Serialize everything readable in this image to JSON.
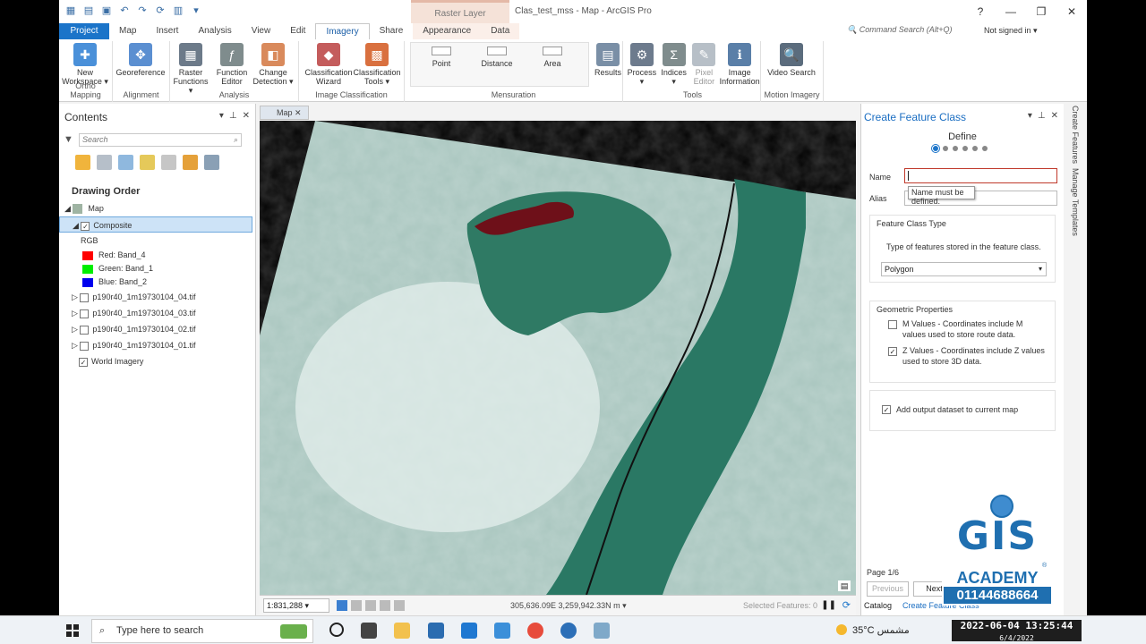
{
  "window": {
    "context_label": "Raster Layer",
    "title": "Clas_test_mss - Map - ArcGIS Pro",
    "help": "?",
    "minimize": "—",
    "restore": "❐",
    "close": "✕"
  },
  "tabs": [
    "Project",
    "Map",
    "Insert",
    "Analysis",
    "View",
    "Edit",
    "Imagery",
    "Share",
    "Appearance",
    "Data"
  ],
  "command_search": "Command Search (Alt+Q)",
  "signed_in": "Not signed in ▾",
  "ribbon": {
    "groups": [
      {
        "label": "Ortho Mapping",
        "buttons": [
          {
            "label": "New Workspace ▾",
            "color": "#4a90d9"
          }
        ]
      },
      {
        "label": "Alignment",
        "buttons": [
          {
            "label": "Georeference",
            "color": "#5b8fd1"
          }
        ]
      },
      {
        "label": "Analysis",
        "buttons": [
          {
            "label": "Raster Functions ▾",
            "color": "#6c7a89"
          },
          {
            "label": "Function Editor",
            "color": "#7f8c8d"
          },
          {
            "label": "Change Detection ▾",
            "color": "#d98a5c"
          }
        ]
      },
      {
        "label": "Image Classification",
        "buttons": [
          {
            "label": "Classification Wizard",
            "color": "#c45c5c"
          },
          {
            "label": "Classification Tools ▾",
            "color": "#d9703f"
          }
        ]
      },
      {
        "label": "Tools",
        "buttons": [
          {
            "label": "Process ▾",
            "color": "#6d7b8d"
          },
          {
            "label": "Indices ▾",
            "color": "#7f8c8d"
          },
          {
            "label": "Pixel Editor",
            "color": "#b7bfc7"
          },
          {
            "label": "Image Information",
            "color": "#5a7fa8"
          }
        ]
      },
      {
        "label": "Motion Imagery",
        "buttons": [
          {
            "label": "Video Search",
            "color": "#5b6c7d"
          }
        ]
      }
    ],
    "mensuration": {
      "label": "Mensuration",
      "buttons": [
        "Point",
        "Distance",
        "Area"
      ],
      "results": "Results"
    }
  },
  "contents": {
    "title": "Contents",
    "search_placeholder": "Search",
    "drawing_order": "Drawing Order",
    "map": "Map",
    "layers": {
      "composite": "Composite",
      "rgb": "RGB",
      "red": "Red:   Band_4",
      "green": "Green: Band_1",
      "blue": "Blue:  Band_2",
      "b4": "p190r40_1m19730104_04.tif",
      "b3": "p190r40_1m19730104_03.tif",
      "b2": "p190r40_1m19730104_02.tif",
      "b1": "p190r40_1m19730104_01.tif",
      "world": "World Imagery"
    },
    "colors": {
      "red": "#ff0000",
      "green": "#00ee00",
      "blue": "#0000ee"
    }
  },
  "map": {
    "tab": "Map",
    "scale": "1:831,288",
    "coords": "305,636.09E 3,259,942.33N m",
    "selected": "Selected Features: 0"
  },
  "create_feature_class": {
    "title": "Create Feature Class",
    "step": "Define",
    "name_label": "Name",
    "alias_label": "Alias",
    "tooltip": "Name must be defined.",
    "fct_title": "Feature Class Type",
    "fct_desc": "Type of features stored in the feature class.",
    "fct_value": "Polygon",
    "geo_title": "Geometric Properties",
    "m_values": "M Values - Coordinates include M values used to store route data.",
    "z_values": "Z Values - Coordinates include Z values used to store 3D data.",
    "add_output": "Add output dataset to current map",
    "page": "Page 1/6",
    "previous": "Previous",
    "next": "Next",
    "bottom_tabs": [
      "Catalog",
      "Create Feature Class"
    ],
    "side_tabs": [
      "Create Features",
      "Manage Templates"
    ]
  },
  "logo": {
    "gis": "GIS",
    "academy": "ACADEMY",
    "phone": "01144688664",
    "registered": "®"
  },
  "taskbar": {
    "search": "Type here to search",
    "weather": "35°C  مشمس",
    "clock_time": "2022-06-04  13:25:44",
    "clock_date": "6/4/2022"
  }
}
